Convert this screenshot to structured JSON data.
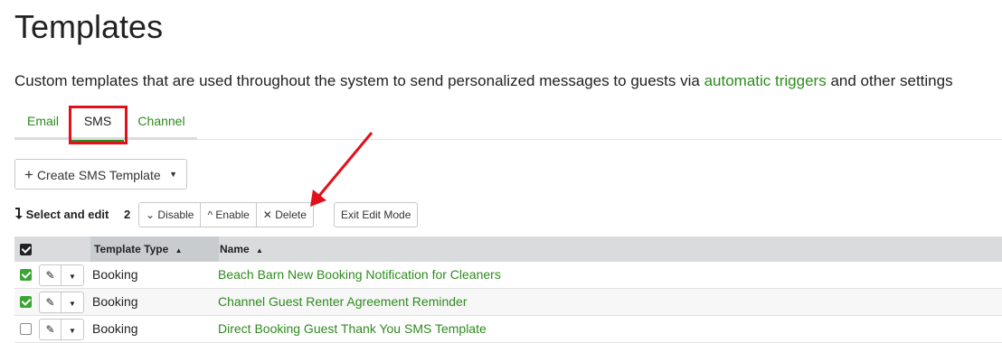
{
  "page": {
    "title": "Templates",
    "description_prefix": "Custom templates that are used throughout the system to send personalized messages to guests via ",
    "description_link": "automatic triggers",
    "description_suffix": " and other settings"
  },
  "tabs": [
    {
      "label": "Email",
      "active": false
    },
    {
      "label": "SMS",
      "active": true
    },
    {
      "label": "Channel",
      "active": false
    }
  ],
  "toolbar": {
    "create_label": "Create SMS Template",
    "select_edit_label": "Select and edit",
    "selected_count": "2",
    "disable_label": "Disable",
    "enable_label": "Enable",
    "delete_label": "Delete",
    "exit_label": "Exit Edit Mode"
  },
  "table": {
    "columns": [
      "Template Type",
      "Name"
    ],
    "rows": [
      {
        "checked": true,
        "type": "Booking",
        "name": "Beach Barn New Booking Notification for Cleaners"
      },
      {
        "checked": true,
        "type": "Booking",
        "name": "Channel Guest Renter Agreement Reminder"
      },
      {
        "checked": false,
        "type": "Booking",
        "name": "Direct Booking Guest Thank You SMS Template"
      }
    ]
  },
  "colors": {
    "accent": "#2e8b1e",
    "highlight": "#e0111b"
  },
  "icons": [
    "plus-icon",
    "caret-down-icon",
    "select-arrow-icon",
    "chevron-down-icon",
    "chevron-up-icon",
    "close-icon",
    "sort-up-icon",
    "pencil-icon"
  ]
}
